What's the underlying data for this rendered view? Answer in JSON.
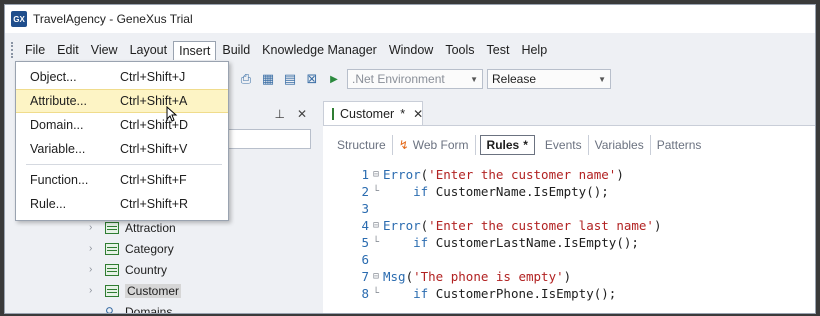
{
  "window": {
    "title": "TravelAgency - GeneXus Trial",
    "logo": "GX"
  },
  "menubar": {
    "items": [
      "File",
      "Edit",
      "View",
      "Layout",
      "Insert",
      "Build",
      "Knowledge Manager",
      "Window",
      "Tools",
      "Test",
      "Help"
    ],
    "open_item": "Insert"
  },
  "toolbar": {
    "environment_placeholder": ".Net Environment",
    "configuration": "Release"
  },
  "insert_menu": {
    "items": [
      {
        "label": "Object...",
        "shortcut": "Ctrl+Shift+J"
      },
      {
        "label": "Attribute...",
        "shortcut": "Ctrl+Shift+A"
      },
      {
        "label": "Domain...",
        "shortcut": "Ctrl+Shift+D"
      },
      {
        "label": "Variable...",
        "shortcut": "Ctrl+Shift+V"
      },
      {
        "label": "Function...",
        "shortcut": "Ctrl+Shift+F"
      },
      {
        "label": "Rule...",
        "shortcut": "Ctrl+Shift+R"
      }
    ],
    "highlighted": "Attribute..."
  },
  "kb_explorer": {
    "pin_icon": "pin-icon",
    "close_icon": "close-icon",
    "tree": [
      "Attraction",
      "Category",
      "Country",
      "Customer",
      "Domains"
    ],
    "selected": "Customer"
  },
  "editor": {
    "tab_label": "Customer",
    "tab_modified_mark": "*",
    "subtabs": [
      "Structure",
      "Web Form",
      "Rules",
      "Events",
      "Variables",
      "Patterns"
    ],
    "active_subtab": "Rules",
    "active_modified_mark": "*",
    "code_lines": [
      {
        "n": "1",
        "fold": "⊟",
        "text": "Error('Enter the customer name')"
      },
      {
        "n": "2",
        "fold": "└",
        "text": "    if CustomerName.IsEmpty();"
      },
      {
        "n": "3",
        "fold": "",
        "text": ""
      },
      {
        "n": "4",
        "fold": "⊟",
        "text": "Error('Enter the customer last name')"
      },
      {
        "n": "5",
        "fold": "└",
        "text": "    if CustomerLastName.IsEmpty();"
      },
      {
        "n": "6",
        "fold": "",
        "text": ""
      },
      {
        "n": "7",
        "fold": "⊟",
        "text": "Msg('The phone is empty')"
      },
      {
        "n": "8",
        "fold": "└",
        "text": "    if CustomerPhone.IsEmpty();"
      }
    ]
  }
}
